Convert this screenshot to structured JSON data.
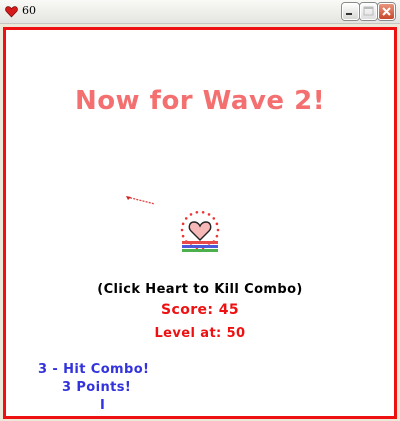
{
  "window": {
    "title": "60"
  },
  "game": {
    "wave_message": "Now for Wave 2!",
    "hint": "(Click Heart to Kill Combo)",
    "score_text": "Score: 45",
    "level_text": "Level at: 50",
    "combo_lines": [
      "3 - Hit Combo!",
      "3 Points!",
      "I"
    ]
  },
  "status_bars": [
    {
      "name": "red",
      "color": "#e84a4a"
    },
    {
      "name": "blue",
      "color": "#4b5ad8"
    },
    {
      "name": "green",
      "color": "#4cb04c"
    }
  ],
  "colors": {
    "border": "#ee1111",
    "wave": "#f47070",
    "score": "#ee1111",
    "combo": "#3333dd",
    "heart_fill": "#f7b8b8"
  }
}
